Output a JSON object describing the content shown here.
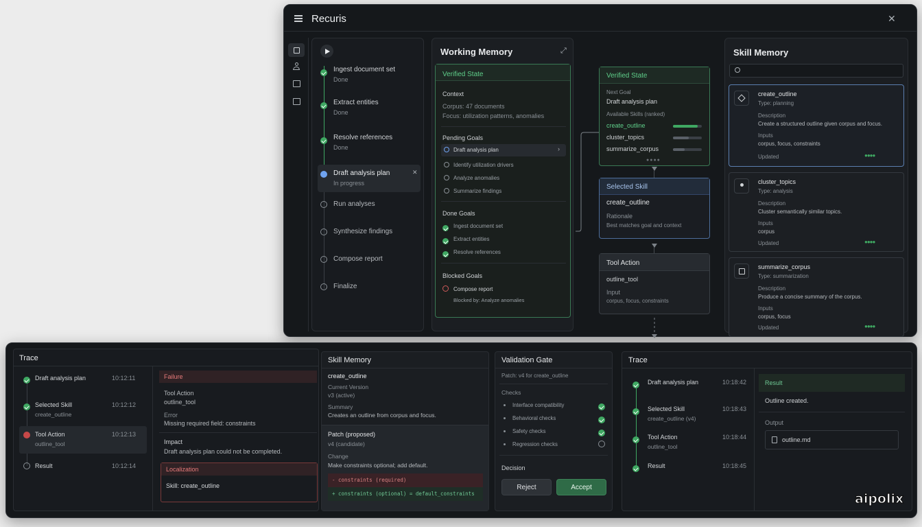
{
  "app": {
    "title": "Recuris"
  },
  "plan": {
    "steps": [
      {
        "label": "Ingest document set",
        "status": "Done"
      },
      {
        "label": "Extract entities",
        "status": "Done"
      },
      {
        "label": "Resolve references",
        "status": "Done"
      },
      {
        "label": "Draft analysis plan",
        "status": "In progress"
      },
      {
        "label": "Run analyses",
        "status": ""
      },
      {
        "label": "Synthesize findings",
        "status": ""
      },
      {
        "label": "Compose report",
        "status": ""
      },
      {
        "label": "Finalize",
        "status": ""
      }
    ]
  },
  "working_memory": {
    "title": "Working Memory",
    "verified": "Verified State",
    "context_h": "Context",
    "corpus": "Corpus: 47 documents",
    "focus": "Focus: utilization patterns, anomalies",
    "pending_h": "Pending Goals",
    "pending": [
      "Draft analysis plan",
      "Identify utilization drivers",
      "Analyze anomalies",
      "Summarize findings"
    ],
    "done_h": "Done Goals",
    "done": [
      "Ingest document set",
      "Extract entities",
      "Resolve references"
    ],
    "blocked_h": "Blocked Goals",
    "blocked": "Compose report",
    "blocked_by": "Blocked by: Analyze anomalies"
  },
  "flow": {
    "verified": "Verified State",
    "next_goal_h": "Next Goal",
    "next_goal": "Draft analysis plan",
    "skills_h": "Available Skills (ranked)",
    "skills": [
      {
        "name": "create_outline",
        "score": 0.85
      },
      {
        "name": "cluster_topics",
        "score": 0.55
      },
      {
        "name": "summarize_corpus",
        "score": 0.4
      }
    ],
    "selected_h": "Selected Skill",
    "selected": "create_outline",
    "rationale_h": "Rationale",
    "rationale": "Best matches goal and context",
    "tool_h": "Tool Action",
    "tool": "outline_tool",
    "input_h": "Input",
    "input": "corpus, focus, constraints"
  },
  "skill_memory": {
    "title": "Skill Memory",
    "search_placeholder": "",
    "cards": [
      {
        "name": "create_outline",
        "type": "Type: planning",
        "desc_h": "Description",
        "desc": "Create a structured outline given corpus and focus.",
        "inputs_h": "Inputs",
        "inputs": "corpus, focus, constraints",
        "updated": "Updated",
        "icon": "outline-icon"
      },
      {
        "name": "cluster_topics",
        "type": "Type: analysis",
        "desc_h": "Description",
        "desc": "Cluster semantically similar topics.",
        "inputs_h": "Inputs",
        "inputs": "corpus",
        "updated": "Updated",
        "icon": "cluster-icon"
      },
      {
        "name": "summarize_corpus",
        "type": "Type: summarization",
        "desc_h": "Description",
        "desc": "Produce a concise summary of the corpus.",
        "inputs_h": "Inputs",
        "inputs": "corpus, focus",
        "updated": "Updated",
        "icon": "document-icon"
      }
    ]
  },
  "trace1": {
    "title": "Trace",
    "rows": [
      {
        "label": "Draft analysis plan",
        "sub": "",
        "time": "10:12:11"
      },
      {
        "label": "Selected Skill",
        "sub": "create_outline",
        "time": "10:12:12"
      },
      {
        "label": "Tool Action",
        "sub": "outline_tool",
        "time": "10:12:13"
      },
      {
        "label": "Result",
        "sub": "",
        "time": "10:12:14"
      }
    ],
    "failure_h": "Failure",
    "tool_h": "Tool Action",
    "tool": "outline_tool",
    "error_h": "Error",
    "error": "Missing required field: constraints",
    "impact_h": "Impact",
    "impact": "Draft analysis plan could not be completed.",
    "loc_h": "Localization",
    "loc": "Skill: create_outline"
  },
  "skill2": {
    "title": "Skill Memory",
    "name": "create_outline",
    "cv_h": "Current Version",
    "cv": "v3 (active)",
    "sum_h": "Summary",
    "sum": "Creates an outline from corpus and focus.",
    "patch_h": "Patch (proposed)",
    "patch": "v4 (candidate)",
    "change_h": "Change",
    "change": "Make constraints optional; add default.",
    "diff_minus": "-  constraints (required)",
    "diff_plus": "+  constraints (optional) = default_constraints"
  },
  "gate": {
    "title": "Validation Gate",
    "patch": "Patch: v4 for create_outline",
    "checks_h": "Checks",
    "checks": [
      {
        "label": "Interface compatibility",
        "ok": true
      },
      {
        "label": "Behavioral checks",
        "ok": true
      },
      {
        "label": "Safety checks",
        "ok": true
      },
      {
        "label": "Regression checks",
        "ok": false
      }
    ],
    "decision_h": "Decision",
    "reject": "Reject",
    "accept": "Accept"
  },
  "trace2": {
    "title": "Trace",
    "rows": [
      {
        "label": "Draft analysis plan",
        "sub": "",
        "time": "10:18:42"
      },
      {
        "label": "Selected Skill",
        "sub": "create_outline (v4)",
        "time": "10:18:43"
      },
      {
        "label": "Tool Action",
        "sub": "outline_tool",
        "time": "10:18:44"
      },
      {
        "label": "Result",
        "sub": "",
        "time": "10:18:45"
      }
    ],
    "result_h": "Result",
    "result": "Outline created.",
    "output_h": "Output",
    "file": "outline.md"
  },
  "brand": {
    "logo": "aipolix"
  },
  "colors": {
    "accent_green": "#3fa862",
    "accent_blue": "#6fa3f0",
    "error_red": "#c64848"
  }
}
